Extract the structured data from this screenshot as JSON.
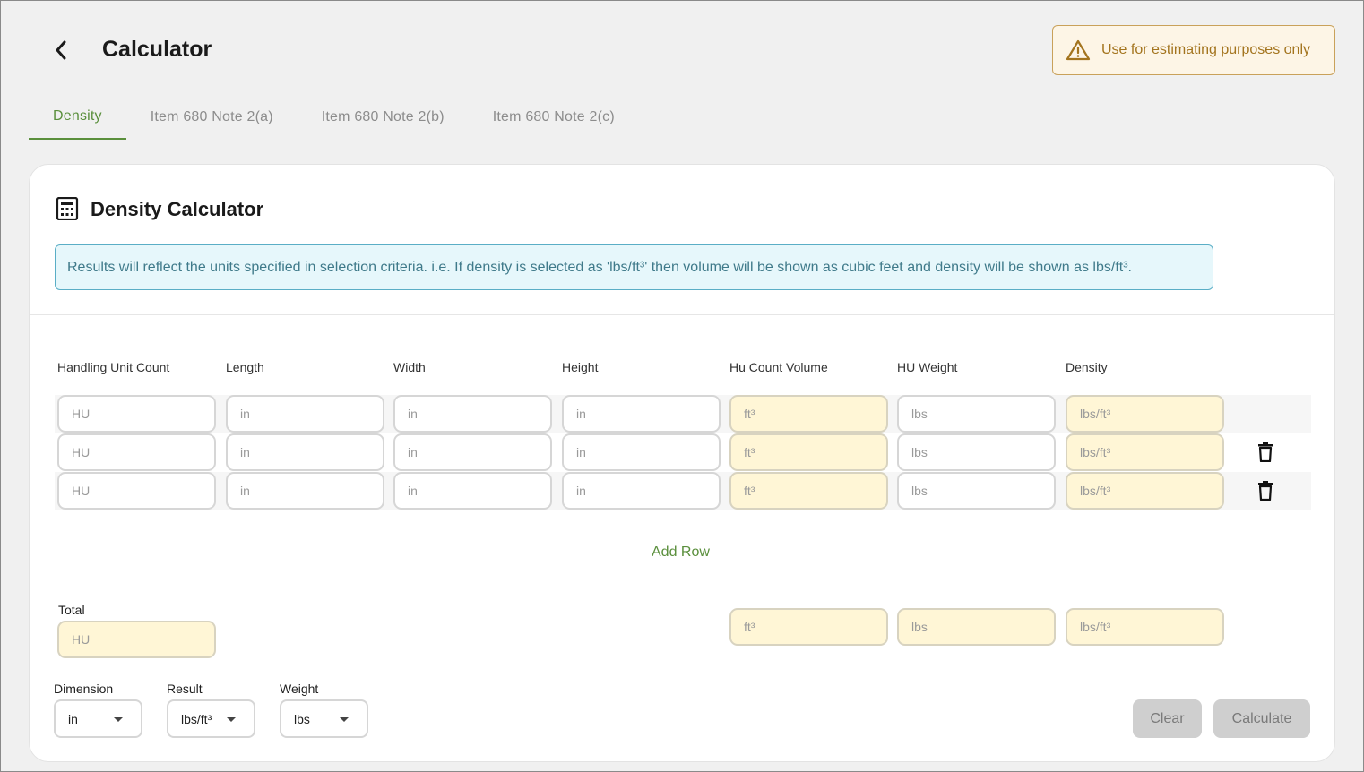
{
  "header": {
    "title": "Calculator",
    "warning": "Use for estimating purposes only"
  },
  "tabs": [
    {
      "label": "Density",
      "active": true
    },
    {
      "label": "Item 680 Note 2(a)",
      "active": false
    },
    {
      "label": "Item 680 Note 2(b)",
      "active": false
    },
    {
      "label": "Item 680 Note 2(c)",
      "active": false
    }
  ],
  "card": {
    "title": "Density Calculator",
    "info": "Results will reflect the units specified in selection criteria. i.e. If density is selected as 'lbs/ft³' then volume will be shown as cubic feet and density will be shown as lbs/ft³."
  },
  "columns": [
    "Handling Unit Count",
    "Length",
    "Width",
    "Height",
    "Hu Count Volume",
    "HU Weight",
    "Density"
  ],
  "placeholders": {
    "hu": "HU",
    "length": "in",
    "width": "in",
    "height": "in",
    "volume": "ft³",
    "weight": "lbs",
    "density": "lbs/ft³"
  },
  "add_row_label": "Add Row",
  "total": {
    "label": "Total",
    "hu_placeholder": "HU",
    "volume_placeholder": "ft³",
    "weight_placeholder": "lbs",
    "density_placeholder": "lbs/ft³"
  },
  "selects": {
    "dimension": {
      "label": "Dimension",
      "value": "in"
    },
    "result": {
      "label": "Result",
      "value": "lbs/ft³"
    },
    "weight": {
      "label": "Weight",
      "value": "lbs"
    }
  },
  "buttons": {
    "clear": "Clear",
    "calculate": "Calculate"
  },
  "colors": {
    "accent": "#5a8f3c",
    "warning": "#a3741e",
    "info": "#3f7a8a",
    "calc_field": "#fff6d6"
  }
}
